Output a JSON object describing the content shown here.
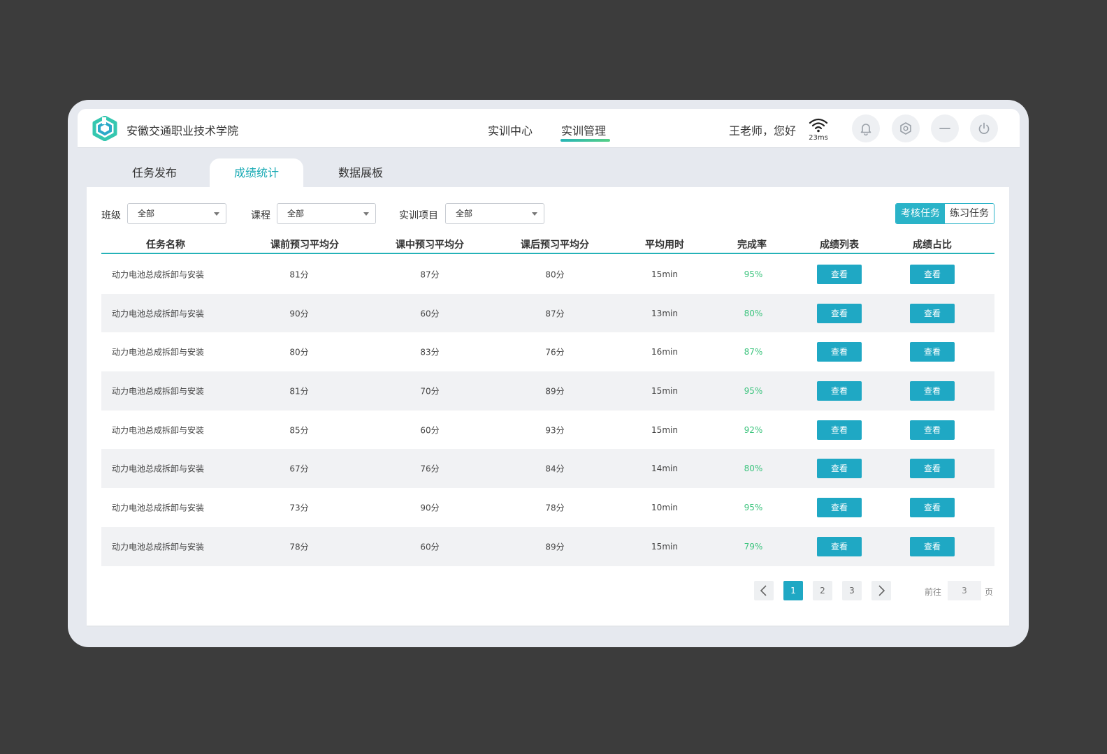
{
  "header": {
    "school_name": "安徽交通职业技术学院",
    "nav": [
      {
        "label": "实训中心",
        "active": false
      },
      {
        "label": "实训管理",
        "active": true
      }
    ],
    "greeting": "王老师，您好",
    "latency": "23ms",
    "icons": [
      "bell-icon",
      "settings-icon",
      "minimize-icon",
      "power-icon"
    ]
  },
  "tabs": [
    {
      "label": "任务发布",
      "active": false
    },
    {
      "label": "成绩统计",
      "active": true
    },
    {
      "label": "数据展板",
      "active": false
    }
  ],
  "filters": {
    "class_label": "班级",
    "class_value": "全部",
    "course_label": "课程",
    "course_value": "全部",
    "project_label": "实训项目",
    "project_value": "全部"
  },
  "toggle": {
    "on": "考核任务",
    "off": "练习任务"
  },
  "table": {
    "headers": [
      "任务名称",
      "课前预习平均分",
      "课中预习平均分",
      "课后预习平均分",
      "平均用时",
      "完成率",
      "成绩列表",
      "成绩占比"
    ],
    "button_label": "查看",
    "rows": [
      {
        "name": "动力电池总成拆卸与安装",
        "pre": "81分",
        "mid": "87分",
        "post": "80分",
        "time": "15min",
        "rate": "95%"
      },
      {
        "name": "动力电池总成拆卸与安装",
        "pre": "90分",
        "mid": "60分",
        "post": "87分",
        "time": "13min",
        "rate": "80%"
      },
      {
        "name": "动力电池总成拆卸与安装",
        "pre": "80分",
        "mid": "83分",
        "post": "76分",
        "time": "16min",
        "rate": "87%"
      },
      {
        "name": "动力电池总成拆卸与安装",
        "pre": "81分",
        "mid": "70分",
        "post": "89分",
        "time": "15min",
        "rate": "95%"
      },
      {
        "name": "动力电池总成拆卸与安装",
        "pre": "85分",
        "mid": "60分",
        "post": "93分",
        "time": "15min",
        "rate": "92%"
      },
      {
        "name": "动力电池总成拆卸与安装",
        "pre": "67分",
        "mid": "76分",
        "post": "84分",
        "time": "14min",
        "rate": "80%"
      },
      {
        "name": "动力电池总成拆卸与安装",
        "pre": "73分",
        "mid": "90分",
        "post": "78分",
        "time": "10min",
        "rate": "95%"
      },
      {
        "name": "动力电池总成拆卸与安装",
        "pre": "78分",
        "mid": "60分",
        "post": "89分",
        "time": "15min",
        "rate": "79%"
      }
    ]
  },
  "pagination": {
    "pages": [
      "1",
      "2",
      "3"
    ],
    "current": "1",
    "goto_prefix": "前往",
    "goto_value": "3",
    "goto_suffix": "页"
  },
  "colors": {
    "accent": "#1fa8c4",
    "tab_active": "#19aab4",
    "rate_green": "#3dc47e",
    "background": "#3c3c3c"
  }
}
